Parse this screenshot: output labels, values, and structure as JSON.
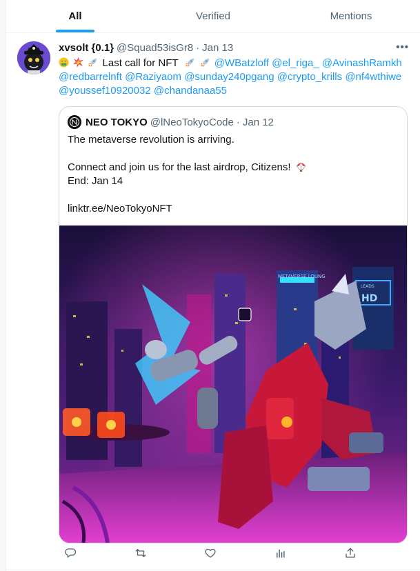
{
  "tabs": [
    {
      "label": "All",
      "active": true
    },
    {
      "label": "Verified",
      "active": false
    },
    {
      "label": "Mentions",
      "active": false
    }
  ],
  "tweet": {
    "name": "xvsolt {0.1}",
    "handle": "@Squad53isGr8",
    "sep": "·",
    "date": "Jan 13",
    "more": "•••",
    "emoji_prefix": [
      "money-mouth-face-emoji",
      "collision-emoji",
      "rocket-emoji"
    ],
    "text_lead": "Last call for NFT",
    "emoji_mid": [
      "rocket-emoji",
      "rocket-emoji"
    ],
    "mentions": [
      "@WBatzloff",
      "@el_riga_",
      "@AvinashRamkh",
      "@redbarrelnft",
      "@Raziyaom",
      "@sunday240pgang",
      "@crypto_krills",
      "@nf4wthiwe",
      "@youssef10920032",
      "@chandanaa55"
    ],
    "quote": {
      "name": "NEO TOKYO",
      "handle": "@lNeoTokyoCode",
      "sep": "·",
      "date": "Jan 12",
      "line1": "The metaverse revolution is arriving.",
      "line2": "Connect and join us for the last airdrop, Citizens!",
      "line2_emoji": "parachute-emoji",
      "line3": "End: Jan 14",
      "line4": "linktr.ee/NeoTokyoNFT",
      "image": {
        "signs": [
          "METAVERSE LOUNG",
          "LEADS",
          "HD"
        ]
      }
    },
    "actions": [
      "reply-icon",
      "retweet-icon",
      "like-icon",
      "analytics-icon",
      "share-icon"
    ]
  },
  "colors": {
    "accent": "#1d9bf0",
    "text": "#0f1419",
    "muted": "#536471",
    "border": "#cfd9de"
  }
}
